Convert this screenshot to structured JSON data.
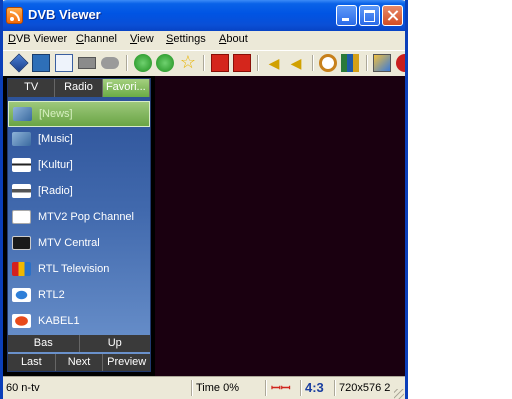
{
  "window": {
    "title": "DVB Viewer"
  },
  "menu": [
    "DVB Viewer",
    "Channel",
    "View",
    "Settings",
    "About"
  ],
  "toolbar": {
    "icons": [
      "osd-icon",
      "channel-list-icon",
      "copy-icon",
      "record-icon",
      "weather-icon",
      "back-icon",
      "forward-icon",
      "favorites-star-icon",
      "previous-channel-icon",
      "next-channel-icon",
      "volume-down-icon",
      "volume-up-icon",
      "timeshift-icon",
      "equalizer-icon",
      "options-icon",
      "record-button-icon"
    ]
  },
  "panel": {
    "tabs": [
      "TV",
      "Radio",
      "Favori..."
    ],
    "active_tab": 2,
    "channels": [
      {
        "label": "[News]",
        "icon": "folder-logo-icon",
        "selected": true
      },
      {
        "label": "[Music]",
        "icon": "folder-logo-icon",
        "selected": false
      },
      {
        "label": "[Kultur]",
        "icon": "folder-logo-icon",
        "selected": false
      },
      {
        "label": "[Radio]",
        "icon": "folder-logo-icon",
        "selected": false
      },
      {
        "label": "MTV2 Pop Channel",
        "icon": "mtv2-logo-icon",
        "selected": false
      },
      {
        "label": "MTV Central",
        "icon": "mtv-logo-icon",
        "selected": false
      },
      {
        "label": "RTL Television",
        "icon": "rtl-logo-icon",
        "selected": false
      },
      {
        "label": "RTL2",
        "icon": "rtl2-logo-icon",
        "selected": false
      },
      {
        "label": "KABEL1",
        "icon": "kabel1-logo-icon",
        "selected": false
      }
    ],
    "row1": [
      "Bas",
      "Up"
    ],
    "row2": [
      "Last",
      "Next",
      "Preview"
    ]
  },
  "status": {
    "channel": "60 n-tv",
    "time": "Time  0%",
    "aspect": "4:3",
    "resolution": "720x576 2"
  },
  "colors": {
    "title_bar": "#0054e3",
    "panel": "#4169ad",
    "selected": "#7cb65a",
    "video_bg": "#1a0010",
    "aspect_text": "#1a3fa0",
    "dolby_red": "#d0241c"
  }
}
